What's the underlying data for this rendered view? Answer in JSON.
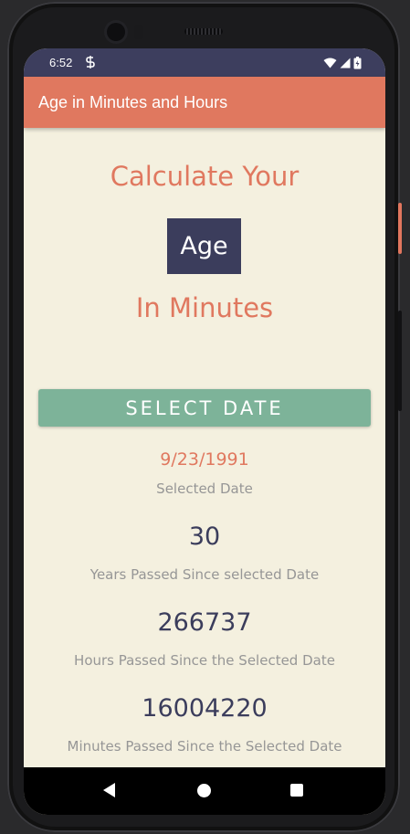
{
  "status_bar": {
    "time": "6:52",
    "app_icon": "s-notification-icon",
    "wifi_icon": "wifi-icon",
    "signal_icon": "cell-signal-icon",
    "battery_icon": "battery-icon"
  },
  "toolbar": {
    "title": "Age in Minutes and Hours"
  },
  "main": {
    "heading_top": "Calculate Your",
    "age_word": "Age",
    "heading_bottom": "In Minutes",
    "select_button_label": "Select Date",
    "selected_date": "9/23/1991",
    "selected_date_label": "Selected Date",
    "years_value": "30",
    "years_label": "Years Passed Since selected Date",
    "hours_value": "266737",
    "hours_label": "Hours Passed Since the Selected Date",
    "minutes_value": "16004220",
    "minutes_label": "Minutes Passed Since the Selected Date"
  },
  "nav_bar": {
    "back_icon": "back-triangle-icon",
    "home_icon": "home-circle-icon",
    "recents_icon": "recents-square-icon"
  },
  "colors": {
    "accent": "#e0785f",
    "primary_dark": "#3b3d5c",
    "button_green": "#7db399",
    "background": "#f4f0df",
    "muted_text": "#969696"
  }
}
